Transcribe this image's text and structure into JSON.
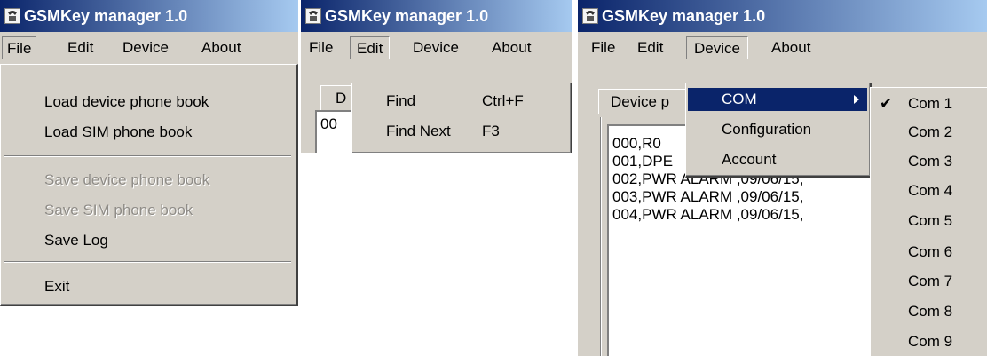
{
  "app_title": "GSMKey manager 1.0",
  "menu": {
    "file": "File",
    "edit": "Edit",
    "device": "Device",
    "about": "About"
  },
  "file_menu": {
    "load_device": "Load device phone book",
    "load_sim": "Load SIM phone book",
    "save_device": "Save device phone book",
    "save_sim": "Save SIM phone book",
    "save_log": "Save Log",
    "exit": "Exit"
  },
  "edit_menu": {
    "find": "Find",
    "find_shortcut": "Ctrl+F",
    "find_next": "Find Next",
    "find_next_shortcut": "F3"
  },
  "panel2_partial": {
    "tab": "D",
    "box": "00"
  },
  "device_menu": {
    "com": "COM",
    "configuration": "Configuration",
    "account": "Account"
  },
  "com_ports": [
    "Com 1",
    "Com 2",
    "Com 3",
    "Com 4",
    "Com 5",
    "Com 6",
    "Com 7",
    "Com 8",
    "Com 9"
  ],
  "checkmark": "✔",
  "tab_label": "Device p",
  "log_lines": [
    "000,R0",
    "001,DPE",
    "002,PWR ALARM ,09/06/15,",
    "003,PWR ALARM ,09/06/15,",
    "004,PWR ALARM ,09/06/15,"
  ]
}
